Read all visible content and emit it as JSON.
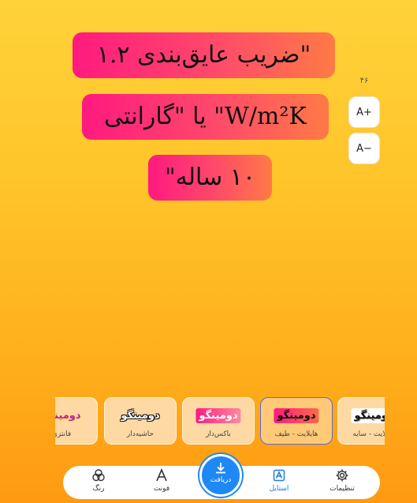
{
  "headline": {
    "line1": "\"ضریب عایق‌بندی ۱.۲",
    "line2": "W/m²K\" یا \"گارانتی",
    "line3": "۱۰ ساله\""
  },
  "font_size": {
    "value": "۴۶",
    "increase_label": "A+",
    "decrease_label": "A−"
  },
  "styles": [
    {
      "sample": "دومینگو",
      "label": "هایلایت - سایه",
      "selected": false
    },
    {
      "sample": "دومینگو",
      "label": "هایلایت - طیف",
      "selected": true
    },
    {
      "sample": "دومینگو",
      "label": "باکس‌دار",
      "selected": false
    },
    {
      "sample": "دومینگو",
      "label": "حاشیه‌دار",
      "selected": false
    },
    {
      "sample": "دومینگو",
      "label": "فانتزی",
      "selected": false
    }
  ],
  "nav": {
    "color": "رنگ",
    "font": "فونت",
    "download": "دریافت",
    "style": "استایل",
    "settings": "تنظیمات"
  },
  "colors": {
    "accent": "#1e88f5",
    "highlight_start": "#ff1a7f",
    "highlight_end": "#ff7a45"
  }
}
